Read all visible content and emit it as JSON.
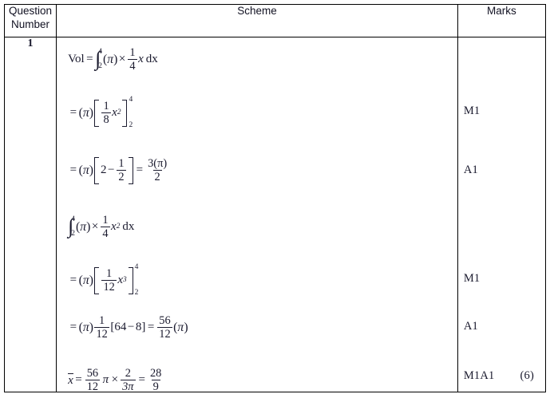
{
  "table": {
    "headers": {
      "question_number": "Question\nNumber",
      "question_number_line1": "Question",
      "question_number_line2": "Number",
      "scheme": "Scheme",
      "marks": "Marks"
    },
    "question_number": "1",
    "lines": [
      {
        "id": "vol-definition",
        "latex": "Vol = \\int_{2}^{4} (\\pi) \\times \\tfrac{1}{4} x \\, dx",
        "plain": "Vol = ∫₂⁴ (π) × 1/4 x dx",
        "mark": "",
        "parts": {
          "label": "Vol",
          "equals": "=",
          "lower_limit": "2",
          "upper_limit": "4",
          "pi": "π",
          "times": "×",
          "numerator": "1",
          "denominator": "4",
          "variable": "x",
          "differential": "dx"
        }
      },
      {
        "id": "antiderivative-linear",
        "latex": "= (\\pi)\\left[\\tfrac{1}{8}x^{2}\\right]_{2}^{4}",
        "plain": "= (π)[ 1/8 x² ]₂⁴",
        "mark": "M1",
        "parts": {
          "equals": "=",
          "pi": "π",
          "numerator": "1",
          "denominator": "8",
          "variable": "x",
          "exponent": "2",
          "lower_limit": "2",
          "upper_limit": "4"
        }
      },
      {
        "id": "evaluate-linear",
        "latex": "= (\\pi)\\left[2-\\tfrac{1}{2}\\right] = \\frac{3(\\pi)}{2}",
        "plain": "= (π)[2 − 1/2] = 3(π)/2",
        "mark": "A1",
        "parts": {
          "equals": "=",
          "pi": "π",
          "term": "2",
          "minus": "−",
          "numerator": "1",
          "denominator": "2",
          "result_numerator": "3(π)",
          "result_denominator": "2"
        }
      },
      {
        "id": "moment-integral",
        "latex": "\\int_{2}^{4} (\\pi) \\times \\tfrac{1}{4} x^{2} dx",
        "plain": "∫₂⁴ (π) × 1/4 x² dx",
        "mark": "",
        "parts": {
          "lower_limit": "2",
          "upper_limit": "4",
          "pi": "π",
          "times": "×",
          "numerator": "1",
          "denominator": "4",
          "variable": "x",
          "exponent": "2",
          "differential": "dx"
        }
      },
      {
        "id": "antiderivative-quadratic",
        "latex": "= (\\pi)\\left[\\tfrac{1}{12}x^{3}\\right]_{2}^{4}",
        "plain": "= (π)[ 1/12 x³ ]₂⁴",
        "mark": "M1",
        "parts": {
          "equals": "=",
          "pi": "π",
          "numerator": "1",
          "denominator": "12",
          "variable": "x",
          "exponent": "3",
          "lower_limit": "2",
          "upper_limit": "4"
        }
      },
      {
        "id": "evaluate-quadratic",
        "latex": "= (\\pi)\\tfrac{1}{12}[64-8] = \\frac{56}{12}(\\pi)",
        "plain": "= (π) 1/12 [64 − 8] = 56/12 (π)",
        "mark": "A1",
        "parts": {
          "equals": "=",
          "pi": "π",
          "numerator": "1",
          "denominator": "12",
          "bracket_first": "64",
          "minus": "−",
          "bracket_second": "8",
          "result_numerator": "56",
          "result_denominator": "12"
        }
      },
      {
        "id": "centre-of-mass",
        "latex": "\\bar{x} = \\frac{56}{12}\\pi \\times \\frac{2}{3\\pi} = \\frac{28}{9}",
        "plain": "x̄ = 56/12 π × 2/(3π) = 28/9",
        "mark": "M1A1",
        "mark_total": "(6)",
        "parts": {
          "variable": "x",
          "equals": "=",
          "first_numerator": "56",
          "first_denominator": "12",
          "pi": "π",
          "times": "×",
          "second_numerator": "2",
          "second_denominator": "3π",
          "result_numerator": "28",
          "result_denominator": "9"
        }
      }
    ],
    "marks_summary": {
      "codes": [
        "M1",
        "A1",
        "M1",
        "A1",
        "M1A1"
      ],
      "total": "(6)"
    }
  },
  "colors": {
    "border": "#000000",
    "text": "#1a1a2e",
    "background": "#ffffff"
  }
}
